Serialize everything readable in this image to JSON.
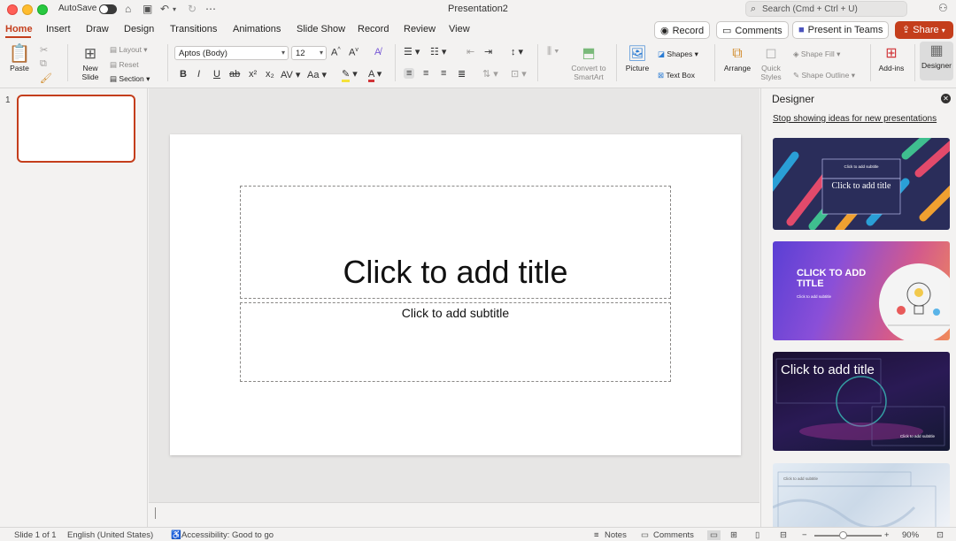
{
  "titlebar": {
    "autosave_label": "AutoSave",
    "document_title": "Presentation2",
    "search_placeholder": "Search (Cmd + Ctrl + U)"
  },
  "tabs": [
    "Home",
    "Insert",
    "Draw",
    "Design",
    "Transitions",
    "Animations",
    "Slide Show",
    "Record",
    "Review",
    "View"
  ],
  "tab_actions": {
    "record": "Record",
    "comments": "Comments",
    "present_teams": "Present in Teams",
    "share": "Share"
  },
  "ribbon": {
    "paste": "Paste",
    "new_slide_1": "New",
    "new_slide_2": "Slide",
    "layout": "Layout",
    "reset": "Reset",
    "section": "Section",
    "font_name": "Aptos (Body)",
    "font_size": "12",
    "convert_smartart_1": "Convert to",
    "convert_smartart_2": "SmartArt",
    "picture": "Picture",
    "shapes": "Shapes",
    "text_box": "Text Box",
    "arrange": "Arrange",
    "quick_styles_1": "Quick",
    "quick_styles_2": "Styles",
    "shape_fill": "Shape Fill",
    "shape_outline": "Shape Outline",
    "add_ins": "Add-ins",
    "designer": "Designer"
  },
  "thumbnails": [
    {
      "number": "1"
    }
  ],
  "slide": {
    "title_placeholder": "Click to add title",
    "subtitle_placeholder": "Click to add subtitle"
  },
  "designer_pane": {
    "title": "Designer",
    "stop_link": "Stop showing ideas for new presentations",
    "design1_title": "Click to add title",
    "design1_sub": "Click to add subtitle",
    "design2_title": "CLICK TO ADD TITLE",
    "design2_sub": "Click to add subtitle",
    "design3_title": "Click to add title",
    "design3_sub": "Click to add subtitle",
    "design4_sub": "Click to add subtitle"
  },
  "statusbar": {
    "slide_info": "Slide 1 of 1",
    "language": "English (United States)",
    "accessibility": "Accessibility: Good to go",
    "notes": "Notes",
    "comments": "Comments",
    "zoom": "90%"
  },
  "colors": {
    "accent": "#c43e1c",
    "background": "#f3f2f1"
  }
}
